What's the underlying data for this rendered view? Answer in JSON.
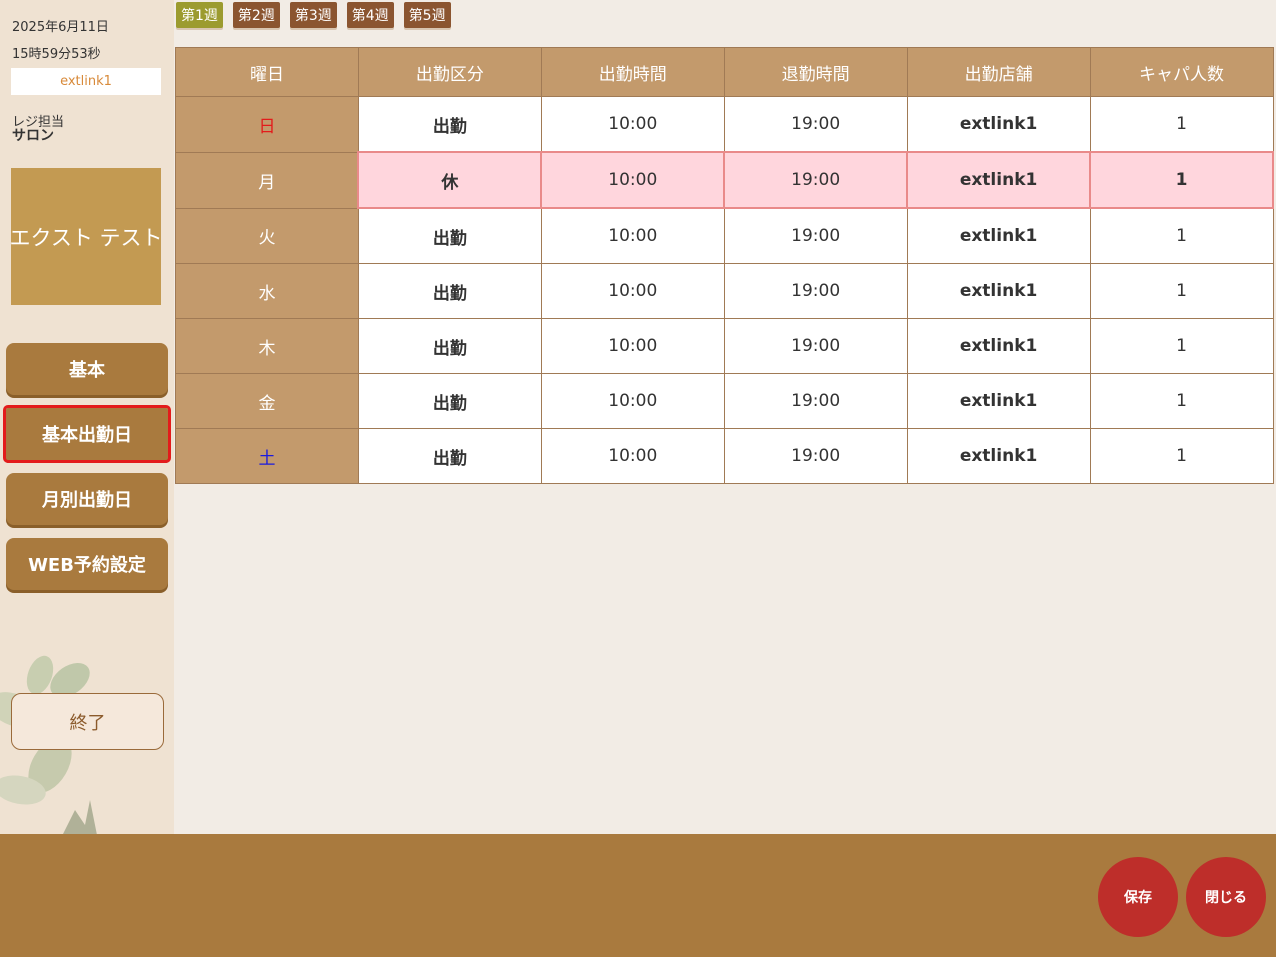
{
  "sidebar": {
    "date": "2025年6月11日",
    "time": "15時59分53秒",
    "store": "extlink1",
    "role_label": "レジ担当",
    "role": "サロン",
    "staff_name": "エクスト テスト",
    "menu": [
      {
        "label": "基本"
      },
      {
        "label": "基本出勤日"
      },
      {
        "label": "月別出勤日"
      },
      {
        "label": "WEB予約設定"
      }
    ],
    "exit_label": "終了"
  },
  "week_tabs": [
    {
      "label": "第1週"
    },
    {
      "label": "第2週"
    },
    {
      "label": "第3週"
    },
    {
      "label": "第4週"
    },
    {
      "label": "第5週"
    }
  ],
  "table": {
    "headers": [
      "曜日",
      "出勤区分",
      "出勤時間",
      "退勤時間",
      "出勤店舗",
      "キャパ人数"
    ],
    "rows": [
      {
        "day": "日",
        "type": "出勤",
        "start": "10:00",
        "end": "19:00",
        "store": "extlink1",
        "capacity": "1"
      },
      {
        "day": "月",
        "type": "休",
        "start": "10:00",
        "end": "19:00",
        "store": "extlink1",
        "capacity": "1"
      },
      {
        "day": "火",
        "type": "出勤",
        "start": "10:00",
        "end": "19:00",
        "store": "extlink1",
        "capacity": "1"
      },
      {
        "day": "水",
        "type": "出勤",
        "start": "10:00",
        "end": "19:00",
        "store": "extlink1",
        "capacity": "1"
      },
      {
        "day": "木",
        "type": "出勤",
        "start": "10:00",
        "end": "19:00",
        "store": "extlink1",
        "capacity": "1"
      },
      {
        "day": "金",
        "type": "出勤",
        "start": "10:00",
        "end": "19:00",
        "store": "extlink1",
        "capacity": "1"
      },
      {
        "day": "土",
        "type": "出勤",
        "start": "10:00",
        "end": "19:00",
        "store": "extlink1",
        "capacity": "1"
      }
    ]
  },
  "footer": {
    "save_label": "保存",
    "close_label": "閉じる"
  },
  "colors": {
    "accent_brown": "#a97a3e",
    "active_week_tab": "#9c9b2f",
    "holiday_row": "#ffd6dd",
    "footer_button": "#be2e2a",
    "sunday": "#e31b1b",
    "saturday": "#1a1ae0"
  },
  "icons": {
    "decoration": "leaf-plant-icon"
  }
}
